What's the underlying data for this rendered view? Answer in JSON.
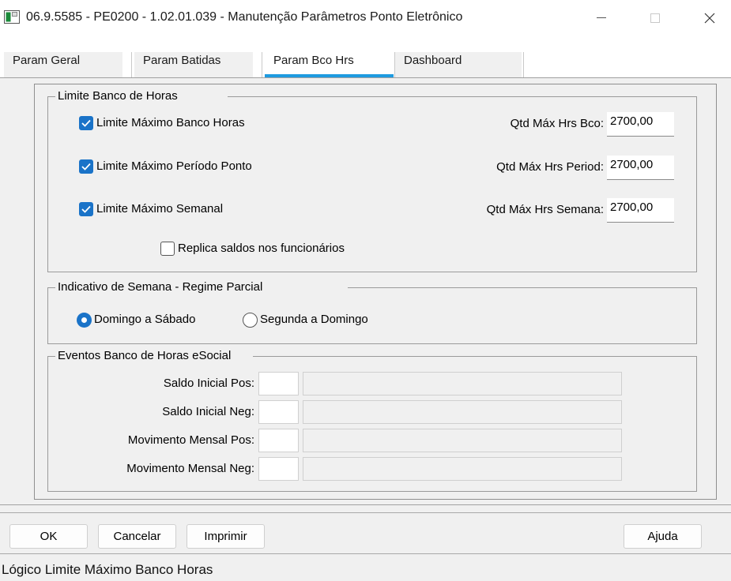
{
  "window": {
    "title": "06.9.5585 - PE0200 - 1.02.01.039 - Manutenção Parâmetros Ponto Eletrônico",
    "minimize_glyph": "—",
    "maximize_glyph": "☐",
    "close_glyph": "✕"
  },
  "tabs": [
    {
      "label": "Param Geral",
      "active": false
    },
    {
      "label": "Param Batidas",
      "active": false
    },
    {
      "label": "Param Bco Hrs",
      "active": true
    },
    {
      "label": "Dashboard",
      "active": false
    }
  ],
  "limite_banco": {
    "title": "Limite Banco de Horas",
    "rows": [
      {
        "checkbox_label": "Limite Máximo Banco Horas",
        "checked": true,
        "field_label": "Qtd Máx Hrs Bco:",
        "value": "2700,00"
      },
      {
        "checkbox_label": "Limite Máximo Período Ponto",
        "checked": true,
        "field_label": "Qtd Máx Hrs Period:",
        "value": "2700,00"
      },
      {
        "checkbox_label": "Limite Máximo Semanal",
        "checked": true,
        "field_label": "Qtd Máx Hrs Semana:",
        "value": "2700,00"
      }
    ],
    "replica": {
      "label": "Replica saldos nos funcionários",
      "checked": false
    }
  },
  "indicativo_semana": {
    "title": "Indicativo de Semana - Regime Parcial",
    "options": [
      {
        "label": "Domingo a Sábado",
        "selected": true
      },
      {
        "label": "Segunda a Domingo",
        "selected": false
      }
    ]
  },
  "eventos": {
    "title": "Eventos Banco de Horas eSocial",
    "rows": [
      {
        "label": "Saldo Inicial Pos:",
        "code": "",
        "description": ""
      },
      {
        "label": "Saldo Inicial Neg:",
        "code": "",
        "description": ""
      },
      {
        "label": "Movimento Mensal Pos:",
        "code": "",
        "description": ""
      },
      {
        "label": "Movimento Mensal Neg:",
        "code": "",
        "description": ""
      }
    ]
  },
  "buttons": {
    "ok": "OK",
    "cancel": "Cancelar",
    "print": "Imprimir",
    "help": "Ajuda"
  },
  "status": "Lógico Limite Máximo Banco Horas",
  "colors": {
    "accent": "#1a73c8",
    "tab_underline": "#1e9be0"
  }
}
